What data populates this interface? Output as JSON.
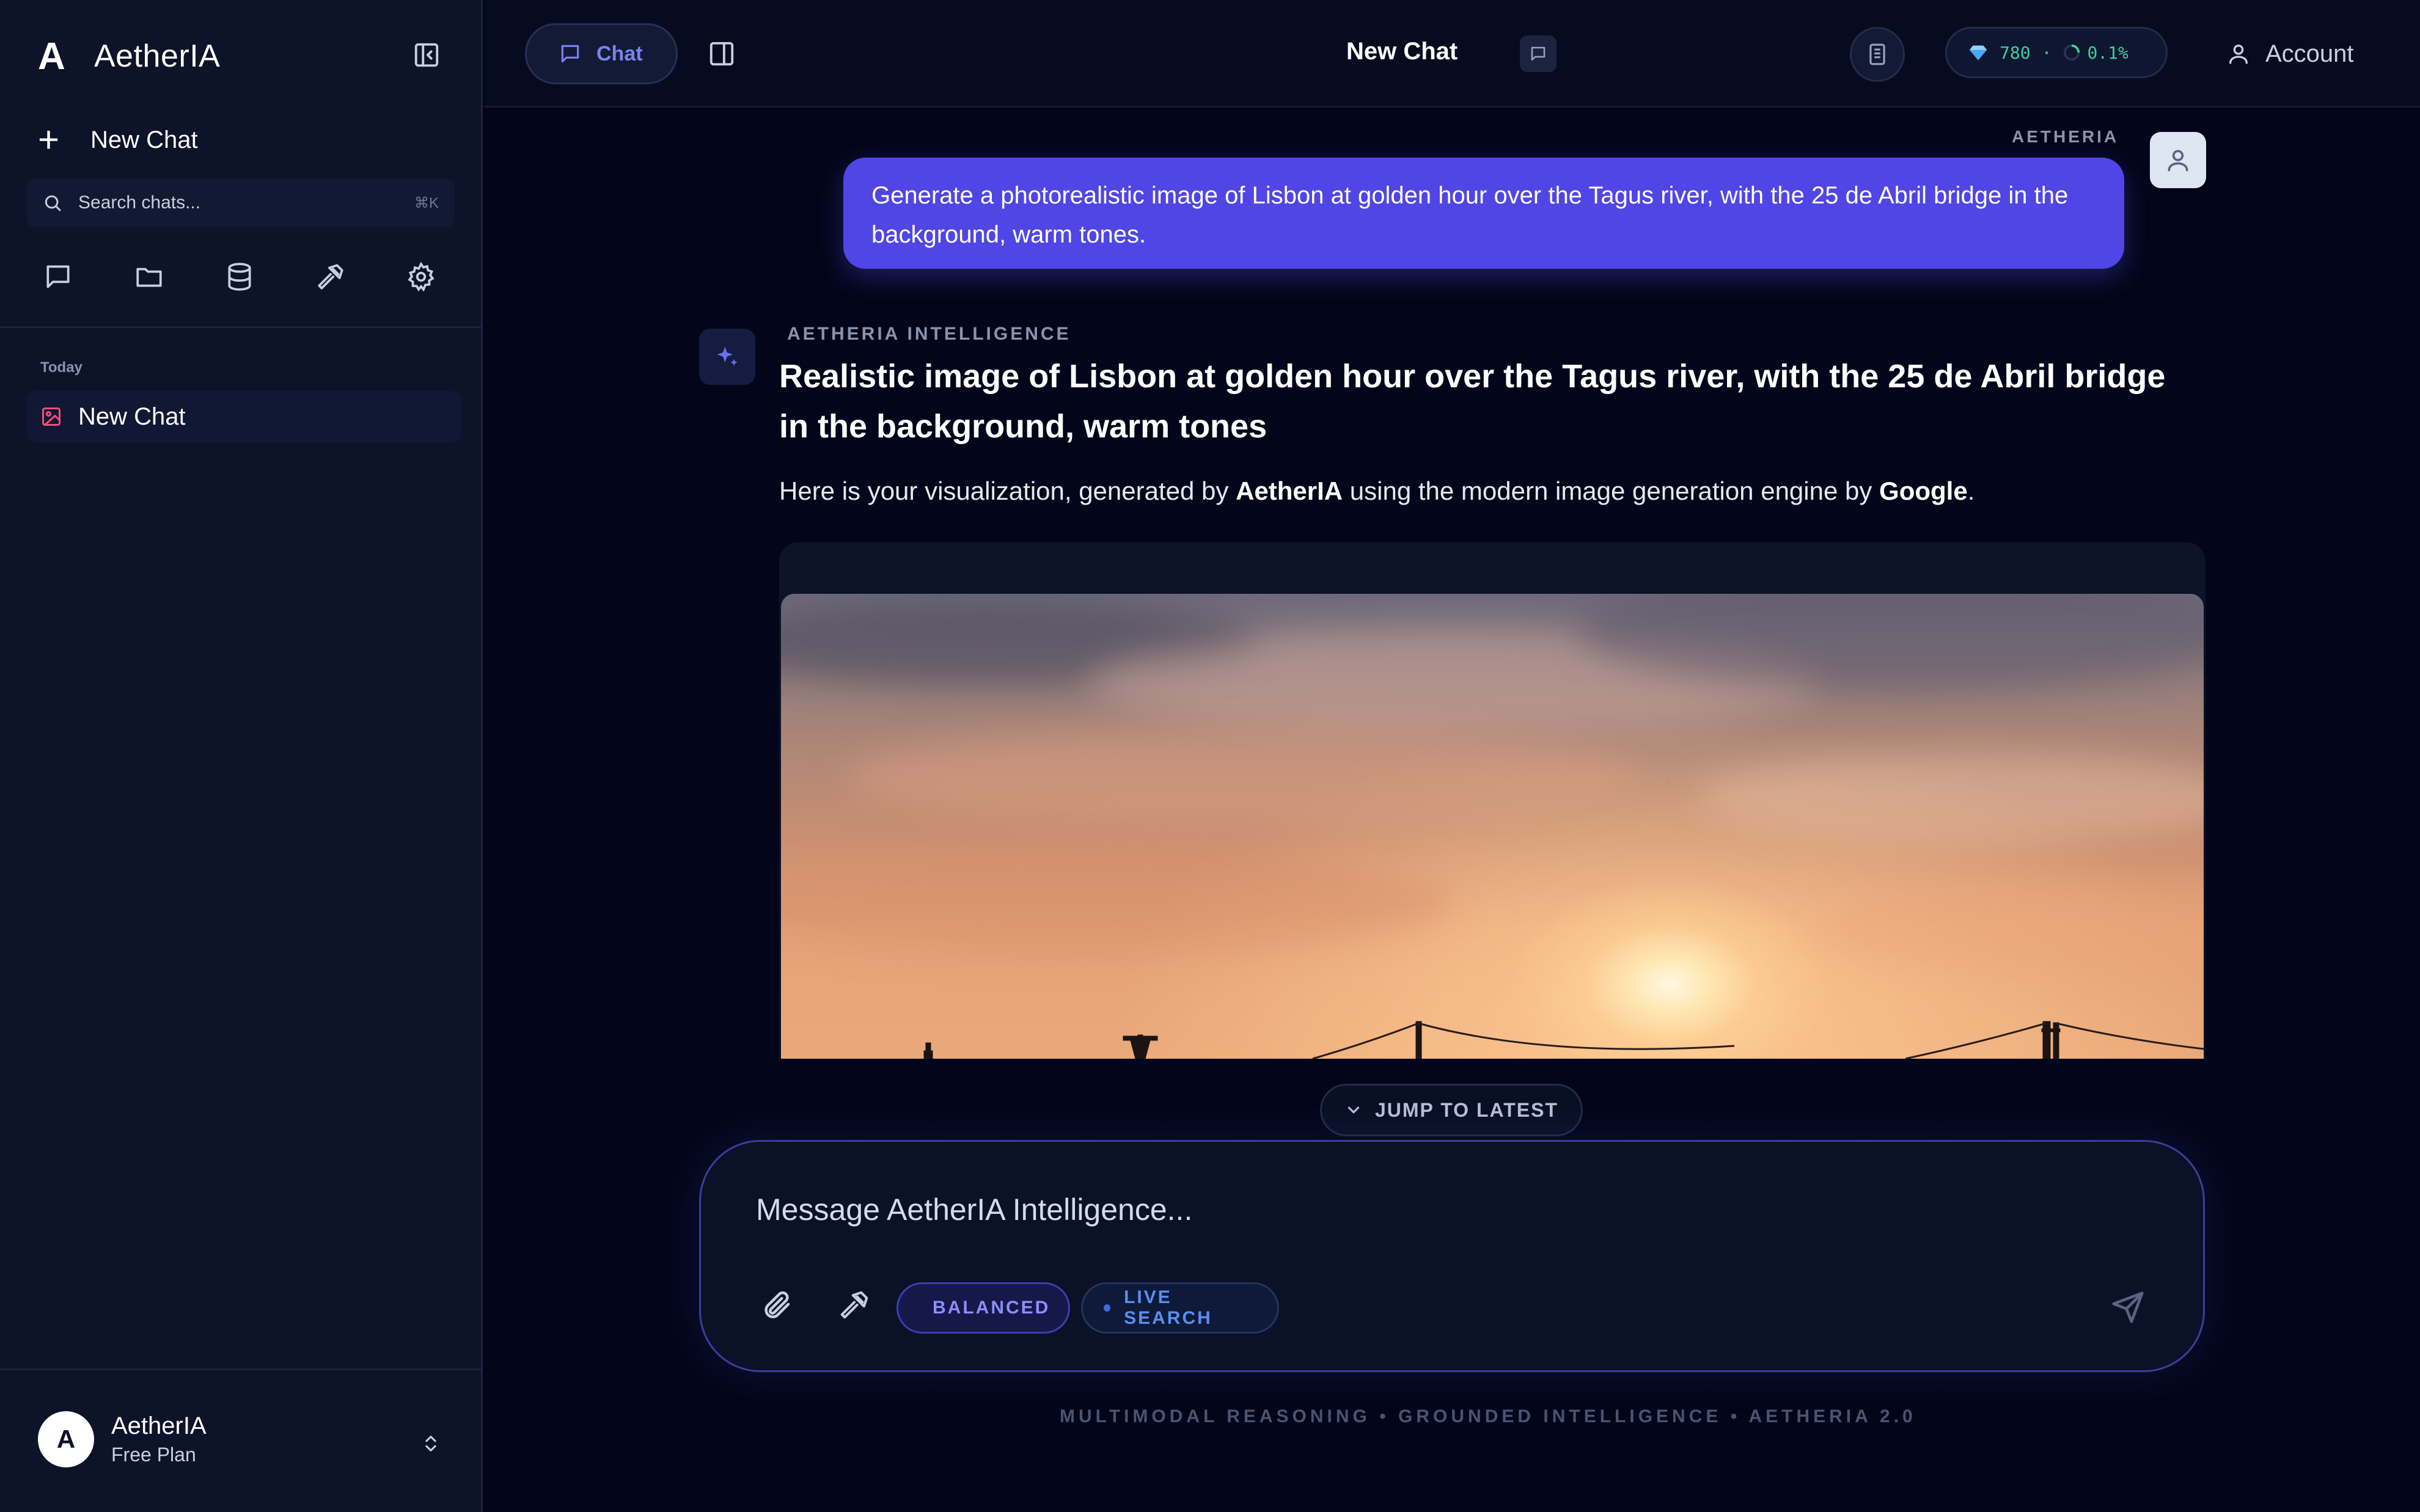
{
  "sidebar": {
    "logo": "A",
    "app_name": "AetherIA",
    "new_chat_label": "New Chat",
    "search": {
      "placeholder": "Search chats...",
      "shortcut": "⌘K"
    },
    "tool_icons": [
      "chat-icon",
      "folder-icon",
      "database-icon",
      "hammer-icon",
      "gear-icon"
    ],
    "section_today": "Today",
    "chats": [
      {
        "label": "New Chat",
        "icon": "image-icon"
      }
    ],
    "user": {
      "avatar_letter": "A",
      "name": "AetherIA",
      "plan": "Free Plan"
    }
  },
  "topbar": {
    "chat_tab_label": "Chat",
    "title": "New Chat",
    "credits": {
      "value": "780",
      "percent": "0.1%"
    },
    "account_label": "Account"
  },
  "conversation": {
    "user_sender": "AETHERIA",
    "user_message": "Generate a photorealistic image of Lisbon at golden hour over the Tagus river, with the 25 de Abril bridge in the background, warm tones.",
    "ai_sender": "AETHERIA INTELLIGENCE",
    "ai_title": "Realistic image of Lisbon at golden hour over the Tagus river, with the 25 de Abril bridge in the background, warm tones",
    "ai_desc": {
      "before": "Here is your visualization, generated by ",
      "brand": "AetherIA",
      "middle": " using the modern image generation engine by ",
      "engine": "Google",
      "after": "."
    }
  },
  "jump_label": "JUMP TO LATEST",
  "composer": {
    "placeholder": "Message AetherIA Intelligence...",
    "mode_label": "BALANCED",
    "search_label": "LIVE SEARCH"
  },
  "footer_text": "MULTIMODAL REASONING • GROUNDED INTELLIGENCE • AETHERIA 2.0",
  "colors": {
    "accent": "#4f46e5",
    "credits": "#3ad0a0",
    "background": "#03061a",
    "sidebar": "#0d1328"
  }
}
